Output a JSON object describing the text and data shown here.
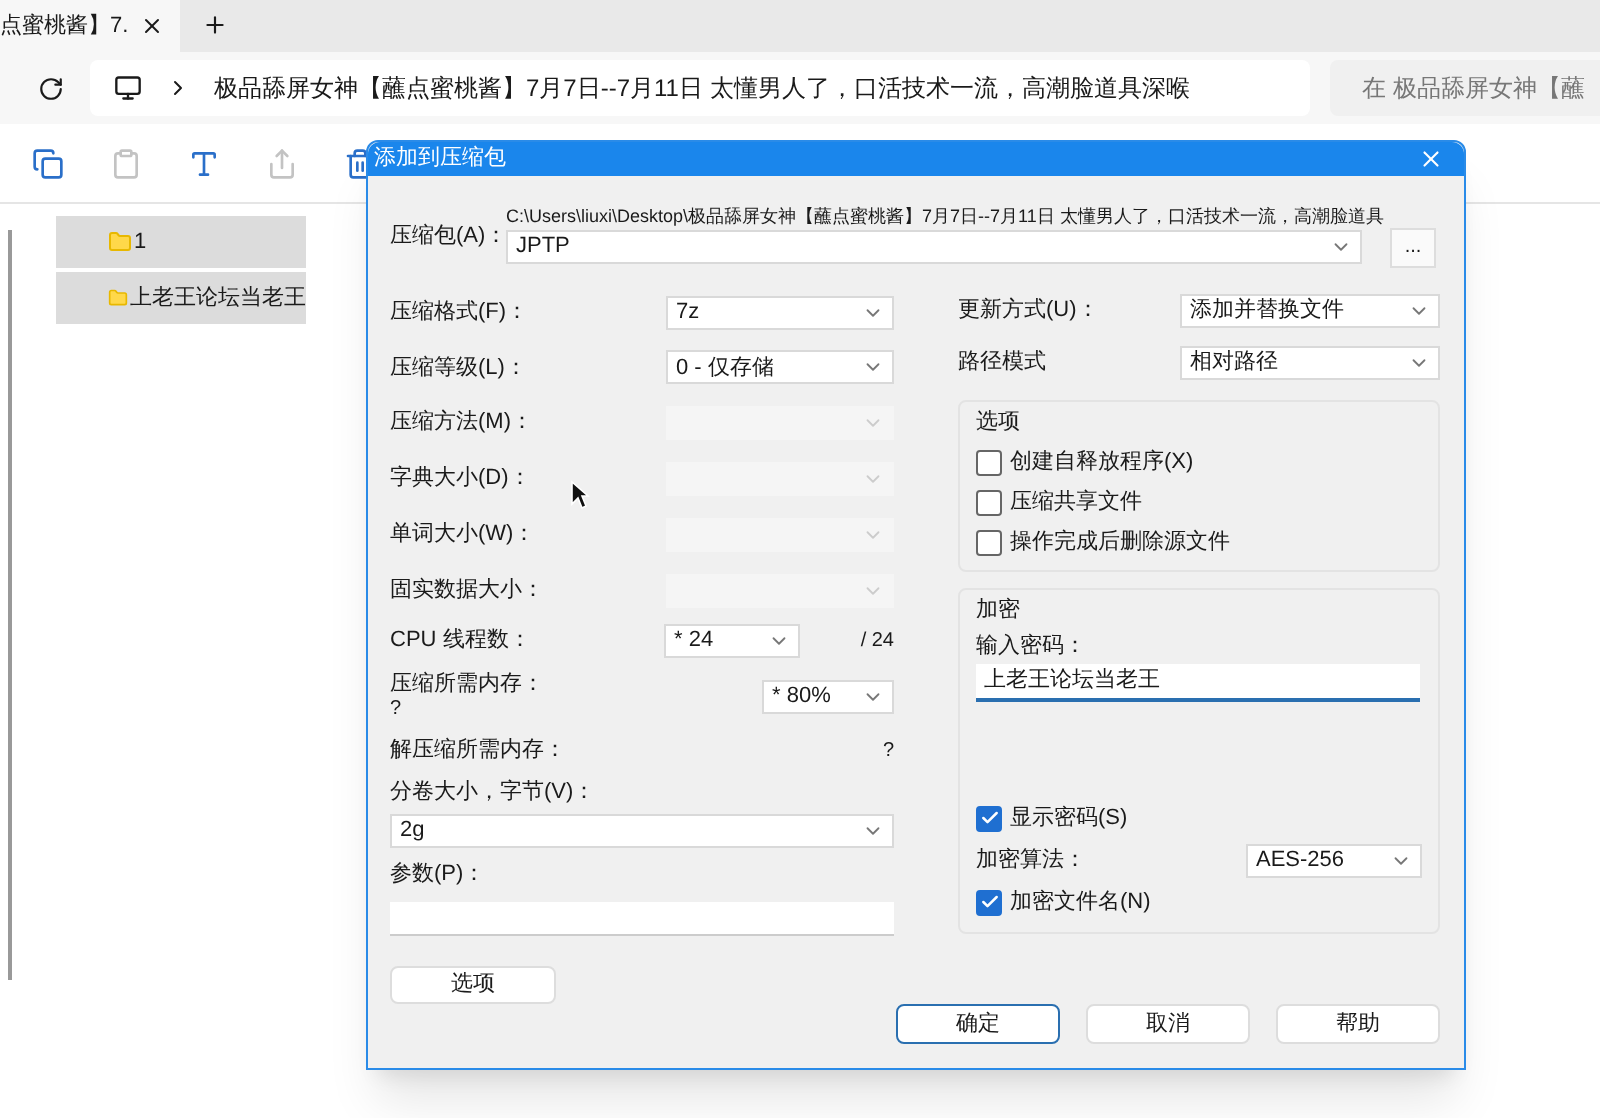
{
  "browser_tab": {
    "title": "点蜜桃酱】7.",
    "selected": true
  },
  "address": {
    "path": "极品舔屏女神【蘸点蜜桃酱】7月7日--7月11日 太懂男人了，口活技术一流，高潮脸道具深喉",
    "search_placeholder": "在 极品舔屏女神【蘸"
  },
  "toolbar": [
    {
      "kind": "copy",
      "disabled": false
    },
    {
      "kind": "paste",
      "disabled": true
    },
    {
      "kind": "rename",
      "disabled": false
    },
    {
      "kind": "share",
      "disabled": true
    },
    {
      "kind": "delete",
      "disabled": false
    }
  ],
  "folders": [
    {
      "name": "1",
      "selected": true
    },
    {
      "name": "上老王论坛当老王",
      "selected": true
    }
  ],
  "dialog": {
    "title": "添加到压缩包",
    "archive": {
      "label": "压缩包(A)：",
      "path": "C:\\Users\\liuxi\\Desktop\\极品舔屏女神【蘸点蜜桃酱】7月7日--7月11日 太懂男人了，口活技术一流，高潮脸道具",
      "value": "JPTP",
      "browse": "..."
    },
    "left_fields": [
      {
        "label": "压缩格式(F)：",
        "value": "7z",
        "disabled": false
      },
      {
        "label": "压缩等级(L)：",
        "value": "0 - 仅存储",
        "disabled": false
      },
      {
        "label": "压缩方法(M)：",
        "disabled": true
      },
      {
        "label": "字典大小(D)：",
        "disabled": true
      },
      {
        "label": "单词大小(W)：",
        "disabled": true
      },
      {
        "label": "固实数据大小：",
        "disabled": true
      }
    ],
    "cpu": {
      "label": "CPU 线程数：",
      "value": "* 24",
      "max": "/ 24"
    },
    "memory": {
      "label": "压缩所需内存：",
      "reading": "?",
      "value": "* 80%"
    },
    "decompress_memory": {
      "label": "解压缩所需内存：",
      "reading": "?"
    },
    "volume": {
      "label": "分卷大小，字节(V)：",
      "value": "2g"
    },
    "parameters": {
      "label": "参数(P)："
    },
    "options_button": "选项",
    "update_mode": {
      "label": "更新方式(U)：",
      "value": "添加并替换文件"
    },
    "path_mode": {
      "label": "路径模式",
      "value": "相对路径"
    },
    "options": {
      "title": "选项",
      "items": [
        {
          "label": "创建自释放程序(X)",
          "checked": false
        },
        {
          "label": "压缩共享文件",
          "checked": false
        },
        {
          "label": "操作完成后删除源文件",
          "checked": false
        }
      ]
    },
    "encryption": {
      "title": "加密",
      "password_label": "输入密码：",
      "password": "上老王论坛当老王",
      "show_password": {
        "label": "显示密码(S)",
        "checked": true
      },
      "method_label": "加密算法：",
      "method": "AES-256",
      "encrypt_names": {
        "label": "加密文件名(N)",
        "checked": true
      }
    },
    "buttons": [
      {
        "label": "确定",
        "default": true
      },
      {
        "label": "取消",
        "default": false
      },
      {
        "label": "帮助",
        "default": false
      }
    ]
  }
}
